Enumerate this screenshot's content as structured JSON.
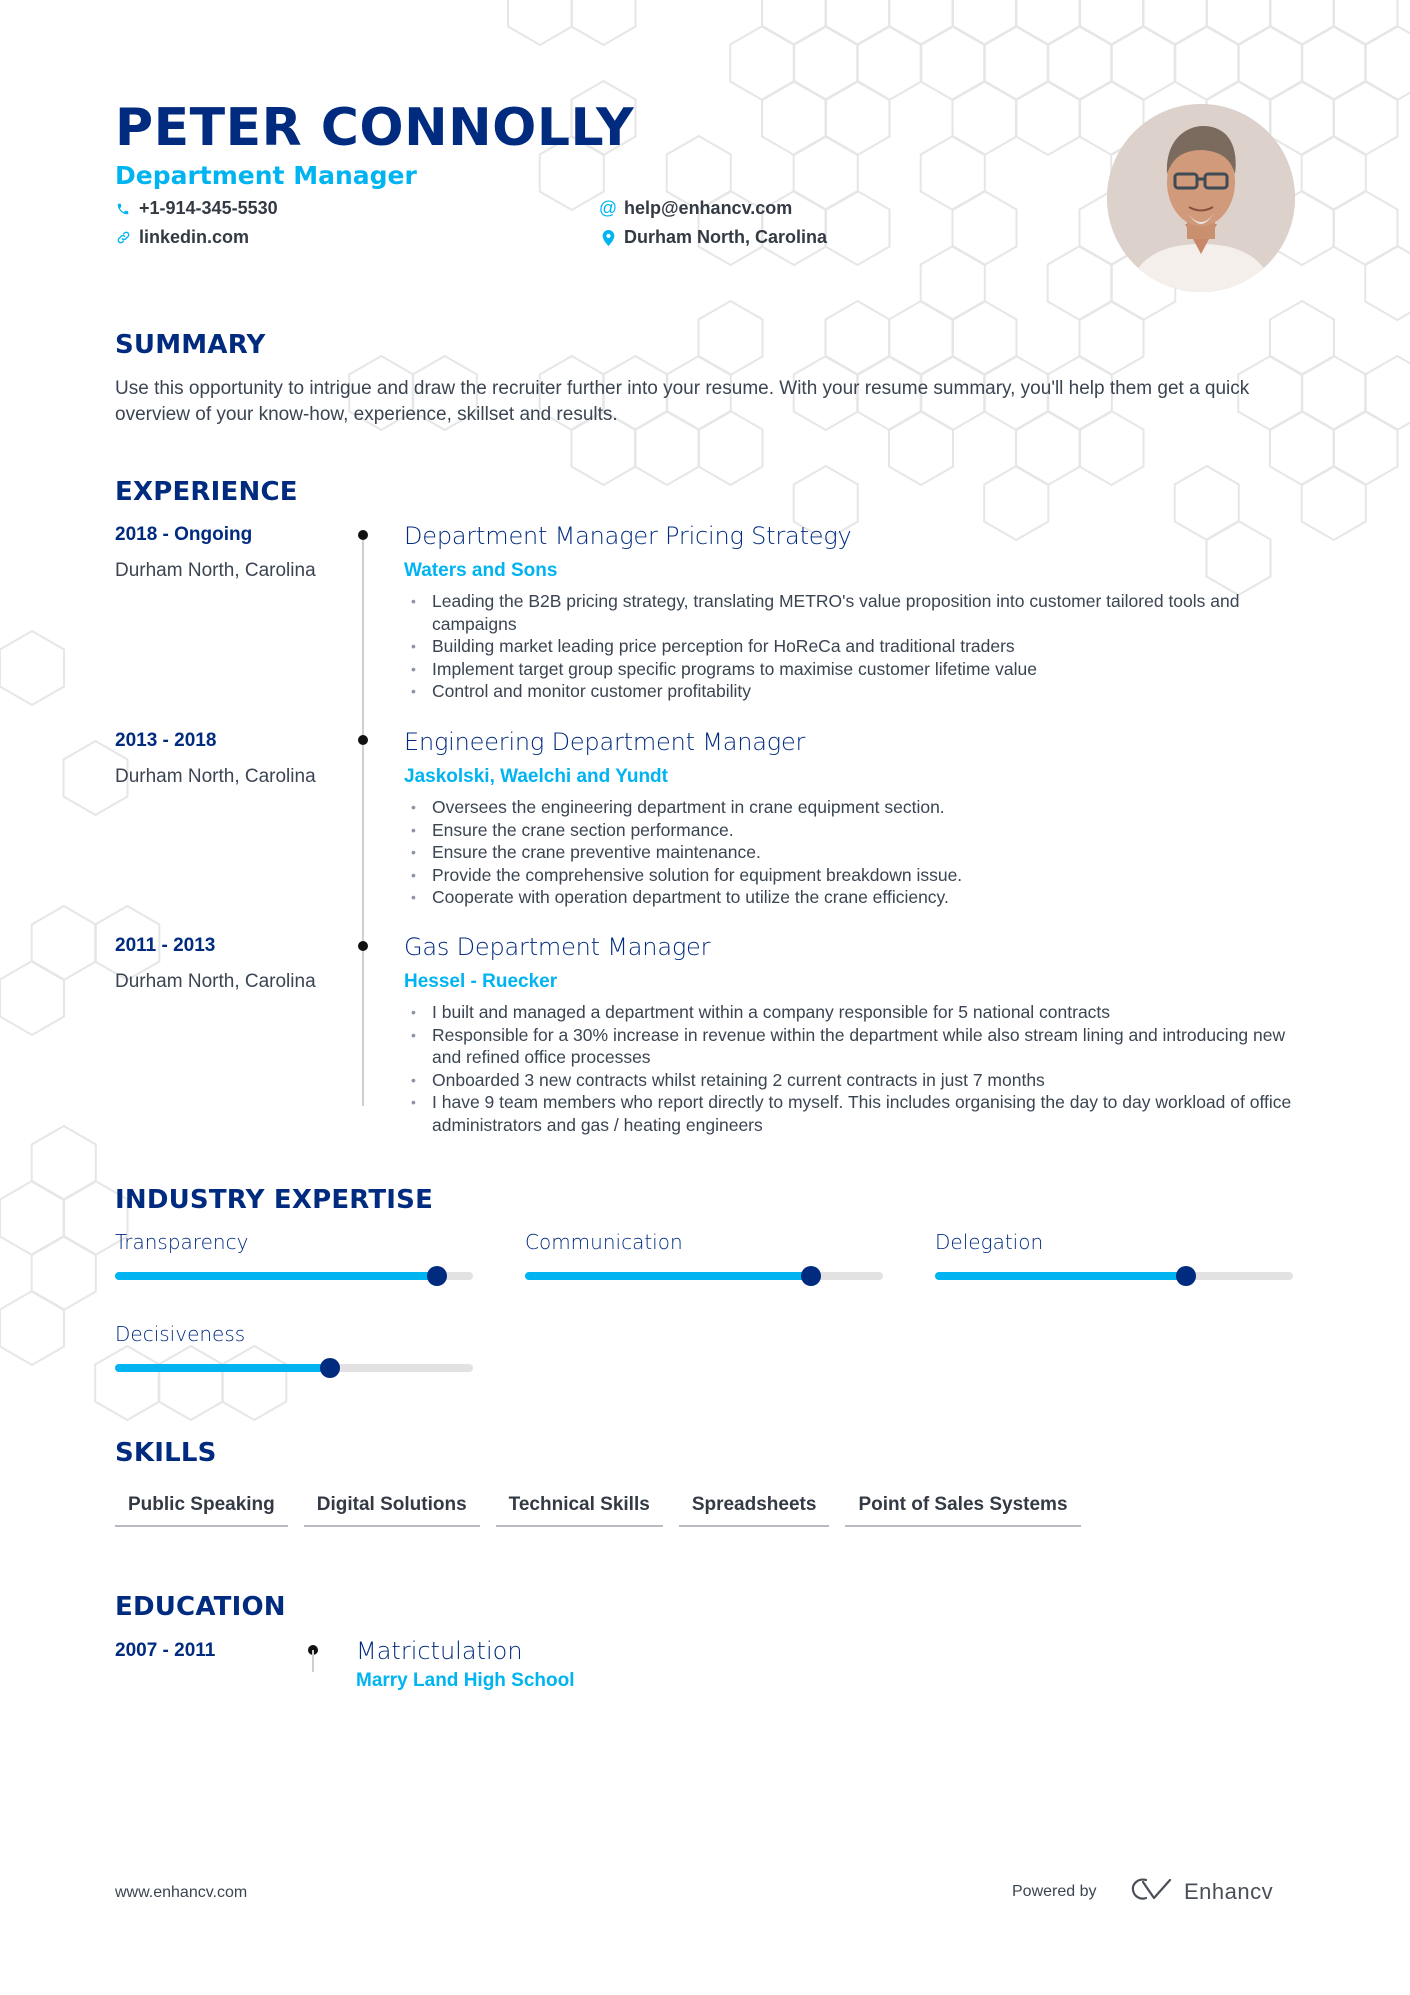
{
  "header": {
    "name": "PETER CONNOLLY",
    "title": "Department Manager",
    "contacts": {
      "phone": {
        "icon": "phone-icon",
        "value": "+1-914-345-5530"
      },
      "email": {
        "icon": "at-icon",
        "value": "help@enhancv.com"
      },
      "linkedin": {
        "icon": "link-icon",
        "value": "linkedin.com"
      },
      "location": {
        "icon": "location-pin-icon",
        "value": "Durham North, Carolina"
      }
    },
    "photo": "profile-photo"
  },
  "summary": {
    "heading": "SUMMARY",
    "text": "Use this opportunity to intrigue and draw the recruiter further into your resume. With your resume summary, you'll help them get a quick overview of your know-how, experience, skillset and results."
  },
  "experience": {
    "heading": "EXPERIENCE",
    "items": [
      {
        "dates": "2018 - Ongoing",
        "location": "Durham North, Carolina",
        "title": "Department Manager Pricing Strategy",
        "company": "Waters and Sons",
        "bullets": [
          "Leading the B2B pricing strategy, translating METRO's value proposition into customer tailored tools and campaigns",
          "Building market leading price perception for HoReCa and traditional traders",
          "Implement target group specific programs to maximise customer lifetime value",
          "Control and monitor customer profitability"
        ]
      },
      {
        "dates": "2013 - 2018",
        "location": "Durham North, Carolina",
        "title": "Engineering Department Manager",
        "company": "Jaskolski, Waelchi and Yundt",
        "bullets": [
          "Oversees the engineering department in crane equipment section.",
          "Ensure the crane section performance.",
          "Ensure the crane preventive maintenance.",
          "Provide the comprehensive solution for equipment breakdown issue.",
          "Cooperate with operation department to utilize the crane efficiency."
        ]
      },
      {
        "dates": "2011 - 2013",
        "location": "Durham North, Carolina",
        "title": "Gas Department Manager",
        "company": "Hessel - Ruecker",
        "bullets": [
          "I built and managed a department within a company responsible for 5 national contracts",
          "Responsible for a 30% increase in revenue within the department while also stream lining and introducing new and refined office processes",
          "Onboarded 3 new contracts whilst retaining 2 current contracts in just 7 months",
          "I have 9 team members who report directly to myself. This includes organising the day to day workload of office administrators and gas / heating engineers"
        ]
      }
    ]
  },
  "expertise": {
    "heading": "INDUSTRY EXPERTISE",
    "items": [
      {
        "label": "Transparency",
        "level": 0.9
      },
      {
        "label": "Communication",
        "level": 0.8
      },
      {
        "label": "Delegation",
        "level": 0.7
      },
      {
        "label": "Decisiveness",
        "level": 0.6
      }
    ]
  },
  "skills": {
    "heading": "SKILLS",
    "items": [
      "Public Speaking",
      "Digital Solutions",
      "Technical Skills",
      "Spreadsheets",
      "Point of Sales Systems"
    ]
  },
  "education": {
    "heading": "EDUCATION",
    "items": [
      {
        "dates": "2007 - 2011",
        "degree": "Matrictulation",
        "school": "Marry Land High School"
      }
    ]
  },
  "footer": {
    "url": "www.enhancv.com",
    "powered_by": "Powered by",
    "brand": "Enhancv"
  },
  "colors": {
    "primary": "#002b7f",
    "accent": "#00b4f1",
    "text": "#3b4552",
    "track": "#e2e2e2"
  }
}
